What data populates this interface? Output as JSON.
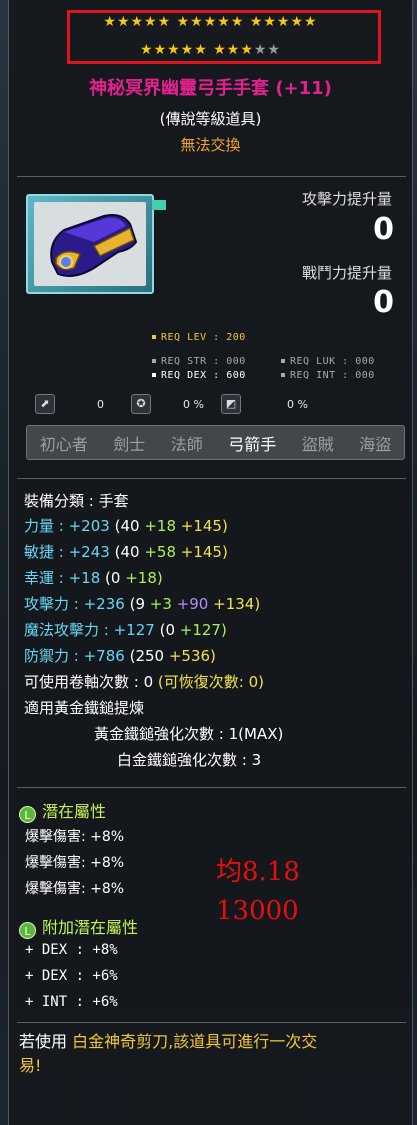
{
  "star_force": {
    "row1": "★★★★★ ★★★★★ ★★★★★",
    "row2_gold": "★★★★★ ★★★",
    "row2_grey": "★★"
  },
  "item": {
    "name": "神秘冥界幽靈弓手手套 (+11)",
    "grade": "(傳說等級道具)",
    "trade": "無法交換"
  },
  "compare": {
    "atk_label": "攻擊力提升量",
    "atk_value": "0",
    "cp_label": "戰鬥力提升量",
    "cp_value": "0"
  },
  "requirements": {
    "lev": "REQ LEV : 200",
    "str": "REQ STR : 000",
    "luk": "REQ LUK : 000",
    "dex": "REQ DEX : 600",
    "int": "REQ INT : 000"
  },
  "resist": {
    "v1": "0",
    "v2": "0 %",
    "v3": "0 %"
  },
  "jobs": [
    "初心者",
    "劍士",
    "法師",
    "弓箭手",
    "盜賊",
    "海盜"
  ],
  "stats": {
    "category": "裝備分類 : 手套",
    "str": {
      "label": "力量 :",
      "total": "+203",
      "base": "(40",
      "bonus": "+18",
      "star": "+145)"
    },
    "dex": {
      "label": "敏捷 :",
      "total": "+243",
      "base": "(40",
      "bonus": "+58",
      "star": "+145)"
    },
    "luk": {
      "label": "幸運 :",
      "total": "+18",
      "base": "(0",
      "bonus": "+18)"
    },
    "atk": {
      "label": "攻擊力 :",
      "total": "+236",
      "base": "(9",
      "bonus": "+3",
      "scroll": "+90",
      "star": "+134)"
    },
    "matk": {
      "label": "魔法攻擊力 :",
      "total": "+127",
      "base": "(0",
      "bonus": "+127)"
    },
    "def": {
      "label": "防禦力 :",
      "total": "+786",
      "base": "(250",
      "bonus": "+536)"
    },
    "upgrades": "可使用卷軸次數 : 0",
    "recover": "(可恢復次數: 0)",
    "hammer": "適用黃金鐵鎚提煉",
    "gold_hammer": "黃金鐵鎚強化次數 : 1(MAX)",
    "plat_hammer": "白金鐵鎚強化次數 : 3"
  },
  "potential": {
    "title": "潛在屬性",
    "badge": "L",
    "lines": [
      "爆擊傷害: +8%",
      "爆擊傷害: +8%",
      "爆擊傷害: +8%"
    ]
  },
  "bonus_potential": {
    "title": "附加潛在屬性",
    "badge": "L",
    "lines": [
      "+ DEX : +8%",
      "+ DEX : +6%",
      "+ INT : +6%"
    ]
  },
  "annotation": {
    "avg": "均8.18",
    "price": "13000"
  },
  "note": {
    "prefix": "若使用",
    "item": "白金神奇剪刀,該道具可進行一次交",
    "suffix": "易!"
  }
}
